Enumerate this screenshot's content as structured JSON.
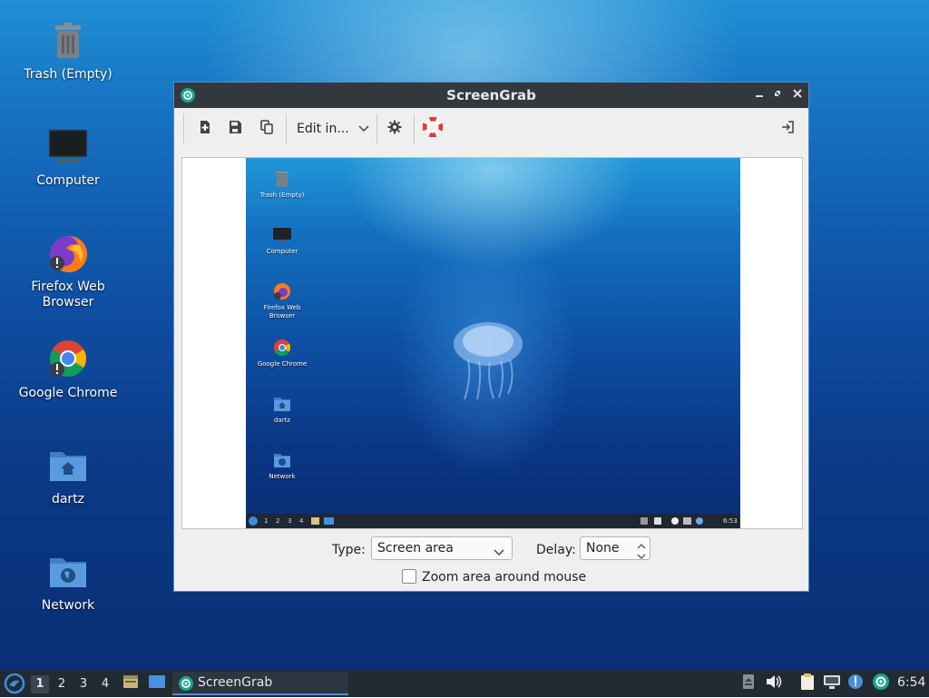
{
  "desktop": {
    "icons": [
      {
        "label": "Trash (Empty)",
        "icon": "trash-icon"
      },
      {
        "label": "Computer",
        "icon": "monitor-icon"
      },
      {
        "label": "Firefox Web Browser",
        "icon": "firefox-icon"
      },
      {
        "label": "Google Chrome",
        "icon": "chrome-icon"
      },
      {
        "label": "dartz",
        "icon": "home-folder-icon"
      },
      {
        "label": "Network",
        "icon": "network-folder-icon"
      }
    ]
  },
  "window": {
    "title": "ScreenGrab",
    "toolbar": {
      "edit_label": "Edit in..."
    },
    "preview": {
      "icons": [
        "Trash (Empty)",
        "Computer",
        "Firefox Web Browser",
        "Google Chrome",
        "dartz",
        "Network"
      ],
      "workspaces": [
        "1",
        "2",
        "3",
        "4"
      ],
      "clock": "6:53"
    },
    "controls": {
      "type_label": "Type:",
      "type_value": "Screen area",
      "delay_label": "Delay:",
      "delay_value": "None",
      "zoom_label": "Zoom area around mouse",
      "zoom_checked": false
    }
  },
  "taskbar": {
    "workspaces": [
      "1",
      "2",
      "3",
      "4"
    ],
    "active_workspace": "1",
    "task_label": "ScreenGrab",
    "clock": "6:54"
  },
  "colors": {
    "titlebar": "#33383e",
    "window_border": "#4c8bd6",
    "taskbar": "#222a33",
    "accent_teal": "#1aa58f"
  }
}
